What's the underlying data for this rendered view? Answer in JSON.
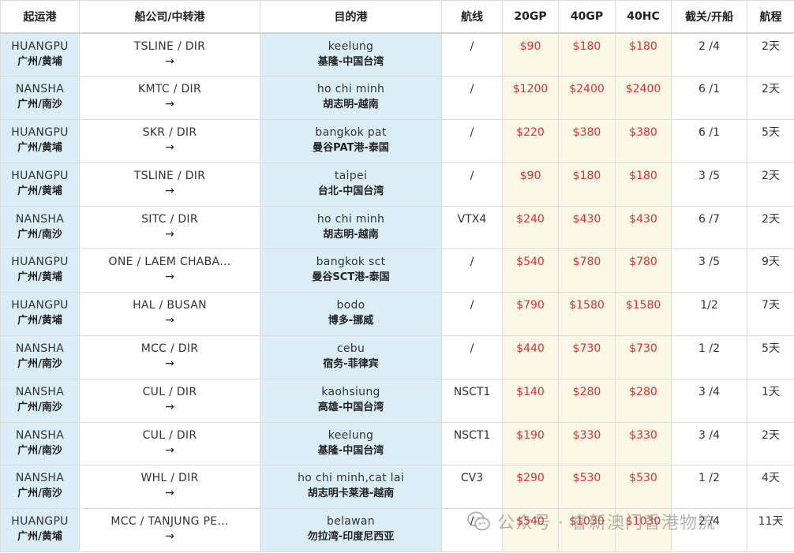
{
  "headers": [
    "起运港",
    "船公司/中转港",
    "目的港",
    "航线",
    "20GP",
    "40GP",
    "40HC",
    "截关/开船",
    "航程"
  ],
  "rows": [
    {
      "origin_en": "HUANGPU",
      "origin_cn": "广州/黄埔",
      "carrier": "TSLINE / DIR",
      "arrow": "→",
      "dest_en": "keelung",
      "dest_cn": "基隆-中国台湾",
      "route": "/",
      "gp20": "$90",
      "gp40": "$180",
      "hc40": "$180",
      "cutoff": "2 /4",
      "transit": "2天"
    },
    {
      "origin_en": "NANSHA",
      "origin_cn": "广州/南沙",
      "carrier": "KMTC / DIR",
      "arrow": "→",
      "dest_en": "ho chi minh",
      "dest_cn": "胡志明-越南",
      "route": "/",
      "gp20": "$1200",
      "gp40": "$2400",
      "hc40": "$2400",
      "cutoff": "6 /1",
      "transit": "2天"
    },
    {
      "origin_en": "HUANGPU",
      "origin_cn": "广州/黄埔",
      "carrier": "SKR / DIR",
      "arrow": "→",
      "dest_en": "bangkok pat",
      "dest_cn": "曼谷PAT港-泰国",
      "route": "/",
      "gp20": "$220",
      "gp40": "$380",
      "hc40": "$380",
      "cutoff": "6 /1",
      "transit": "5天"
    },
    {
      "origin_en": "HUANGPU",
      "origin_cn": "广州/黄埔",
      "carrier": "TSLINE / DIR",
      "arrow": "→",
      "dest_en": "taipei",
      "dest_cn": "台北-中国台湾",
      "route": "/",
      "gp20": "$90",
      "gp40": "$180",
      "hc40": "$180",
      "cutoff": "3 /5",
      "transit": "2天"
    },
    {
      "origin_en": "NANSHA",
      "origin_cn": "广州/南沙",
      "carrier": "SITC / DIR",
      "arrow": "→",
      "dest_en": "ho chi minh",
      "dest_cn": "胡志明-越南",
      "route": "VTX4",
      "gp20": "$240",
      "gp40": "$430",
      "hc40": "$430",
      "cutoff": "6 /7",
      "transit": "2天"
    },
    {
      "origin_en": "HUANGPU",
      "origin_cn": "广州/黄埔",
      "carrier": "ONE / LAEM CHABA...",
      "arrow": "→",
      "dest_en": "bangkok sct",
      "dest_cn": "曼谷SCT港-泰国",
      "route": "/",
      "gp20": "$540",
      "gp40": "$780",
      "hc40": "$780",
      "cutoff": "3 /5",
      "transit": "9天"
    },
    {
      "origin_en": "HUANGPU",
      "origin_cn": "广州/黄埔",
      "carrier": "HAL / BUSAN",
      "arrow": "→",
      "dest_en": "bodo",
      "dest_cn": "博多-挪威",
      "route": "/",
      "gp20": "$790",
      "gp40": "$1580",
      "hc40": "$1580",
      "cutoff": "1/2",
      "transit": "7天"
    },
    {
      "origin_en": "NANSHA",
      "origin_cn": "广州/南沙",
      "carrier": "MCC / DIR",
      "arrow": "→",
      "dest_en": "cebu",
      "dest_cn": "宿务-菲律宾",
      "route": "/",
      "gp20": "$440",
      "gp40": "$730",
      "hc40": "$730",
      "cutoff": "1 /2",
      "transit": "5天"
    },
    {
      "origin_en": "NANSHA",
      "origin_cn": "广州/南沙",
      "carrier": "CUL / DIR",
      "arrow": "→",
      "dest_en": "kaohsiung",
      "dest_cn": "高雄-中国台湾",
      "route": "NSCT1",
      "gp20": "$140",
      "gp40": "$280",
      "hc40": "$280",
      "cutoff": "3 /4",
      "transit": "1天"
    },
    {
      "origin_en": "NANSHA",
      "origin_cn": "广州/南沙",
      "carrier": "CUL / DIR",
      "arrow": "→",
      "dest_en": "keelung",
      "dest_cn": "基隆-中国台湾",
      "route": "NSCT1",
      "gp20": "$190",
      "gp40": "$330",
      "hc40": "$330",
      "cutoff": "3 /4",
      "transit": "2天"
    },
    {
      "origin_en": "NANSHA",
      "origin_cn": "广州/南沙",
      "carrier": "WHL / DIR",
      "arrow": "→",
      "dest_en": "ho chi minh,cat lai",
      "dest_cn": "胡志明卡莱港-越南",
      "route": "CV3",
      "gp20": "$290",
      "gp40": "$530",
      "hc40": "$530",
      "cutoff": "1 /2",
      "transit": "4天"
    },
    {
      "origin_en": "HUANGPU",
      "origin_cn": "广州/黄埔",
      "carrier": "MCC / TANJUNG PE...",
      "arrow": "→",
      "dest_en": "belawan",
      "dest_cn": "勿拉湾-印度尼西亚",
      "route": "/",
      "gp20": "$540",
      "gp40": "$1030",
      "hc40": "$1030",
      "cutoff": "2 /4",
      "transit": "11天"
    }
  ],
  "watermark": {
    "text": "公众号 · 睿新澳门香港物流",
    "icon": "wechat-icon"
  },
  "colors": {
    "blue_column": "#dbeef8",
    "price_column": "#fcf8e6",
    "price_text": "#e03030"
  }
}
